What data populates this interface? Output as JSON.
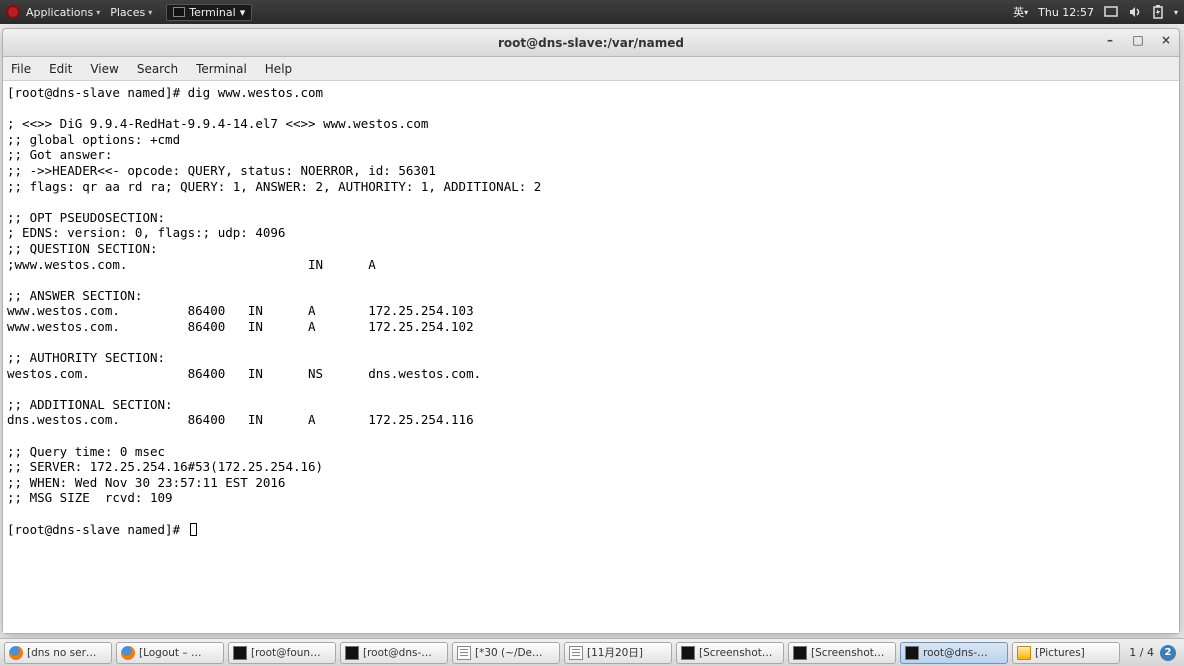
{
  "top_panel": {
    "applications": "Applications",
    "places": "Places",
    "task_terminal": "Terminal",
    "ime": "英",
    "clock": "Thu 12:57"
  },
  "window": {
    "title": "root@dns-slave:/var/named",
    "menu": {
      "file": "File",
      "edit": "Edit",
      "view": "View",
      "search": "Search",
      "terminal": "Terminal",
      "help": "Help"
    }
  },
  "terminal": {
    "prompt1": "[root@dns-slave named]# dig www.westos.com",
    "l1": "",
    "l2": "; <<>> DiG 9.9.4-RedHat-9.9.4-14.el7 <<>> www.westos.com",
    "l3": ";; global options: +cmd",
    "l4": ";; Got answer:",
    "l5": ";; ->>HEADER<<- opcode: QUERY, status: NOERROR, id: 56301",
    "l6": ";; flags: qr aa rd ra; QUERY: 1, ANSWER: 2, AUTHORITY: 1, ADDITIONAL: 2",
    "l7": "",
    "l8": ";; OPT PSEUDOSECTION:",
    "l9": "; EDNS: version: 0, flags:; udp: 4096",
    "l10": ";; QUESTION SECTION:",
    "l11": ";www.westos.com.                        IN      A",
    "l12": "",
    "l13": ";; ANSWER SECTION:",
    "l14": "www.westos.com.         86400   IN      A       172.25.254.103",
    "l15": "www.westos.com.         86400   IN      A       172.25.254.102",
    "l16": "",
    "l17": ";; AUTHORITY SECTION:",
    "l18": "westos.com.             86400   IN      NS      dns.westos.com.",
    "l19": "",
    "l20": ";; ADDITIONAL SECTION:",
    "l21": "dns.westos.com.         86400   IN      A       172.25.254.116",
    "l22": "",
    "l23": ";; Query time: 0 msec",
    "l24": ";; SERVER: 172.25.254.16#53(172.25.254.16)",
    "l25": ";; WHEN: Wed Nov 30 23:57:11 EST 2016",
    "l26": ";; MSG SIZE  rcvd: 109",
    "l27": "",
    "prompt2": "[root@dns-slave named]# "
  },
  "taskbar": {
    "items": [
      {
        "label": "[dns no ser…",
        "icon": "ff"
      },
      {
        "label": "[Logout – …",
        "icon": "ff"
      },
      {
        "label": "[root@foun…",
        "icon": "term"
      },
      {
        "label": "[root@dns-…",
        "icon": "term"
      },
      {
        "label": "[*30 (~/De…",
        "icon": "doc"
      },
      {
        "label": "[11月20日]",
        "icon": "doc"
      },
      {
        "label": "[Screenshot…",
        "icon": "term"
      },
      {
        "label": "[Screenshot…",
        "icon": "term"
      },
      {
        "label": "root@dns-…",
        "icon": "term",
        "active": true
      },
      {
        "label": "[Pictures]",
        "icon": "folder"
      }
    ],
    "workspace": "1 / 4",
    "badge": "2"
  }
}
